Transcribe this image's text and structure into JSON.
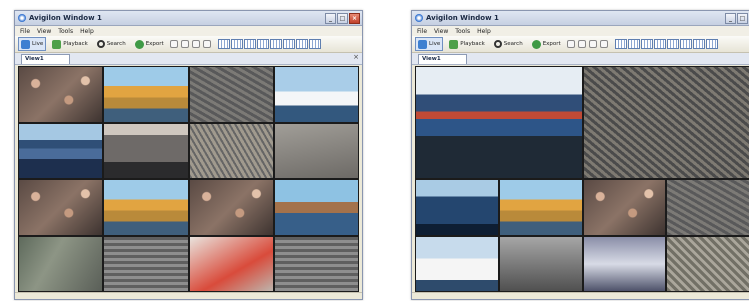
{
  "windows": [
    {
      "title": "Avigilon Window 1",
      "menu": [
        "File",
        "View",
        "Tools",
        "Help"
      ],
      "toolbar": {
        "live": "Live",
        "playback": "Playback",
        "search": "Search",
        "export": "Export"
      },
      "tab": "View1",
      "feeds": [
        "crowd",
        "oil rig",
        "rail yard",
        "cruise ship",
        "cargo ship",
        "car",
        "tracks",
        "parking",
        "crowd",
        "oil rig",
        "crowd",
        "port",
        "road",
        "parking lot",
        "terminal",
        "parking lot"
      ]
    },
    {
      "title": "Avigilon Window 1",
      "menu": [
        "File",
        "View",
        "Tools",
        "Help"
      ],
      "toolbar": {
        "live": "Live",
        "playback": "Playback",
        "search": "Search",
        "export": "Export"
      },
      "tab": "View1",
      "feeds": [
        "cargo ship",
        "rail yard",
        "cargo ship",
        "oil rig",
        "crowd",
        "rail yard",
        "cruise ship",
        "parking lot",
        "lab",
        "tracks"
      ]
    }
  ]
}
